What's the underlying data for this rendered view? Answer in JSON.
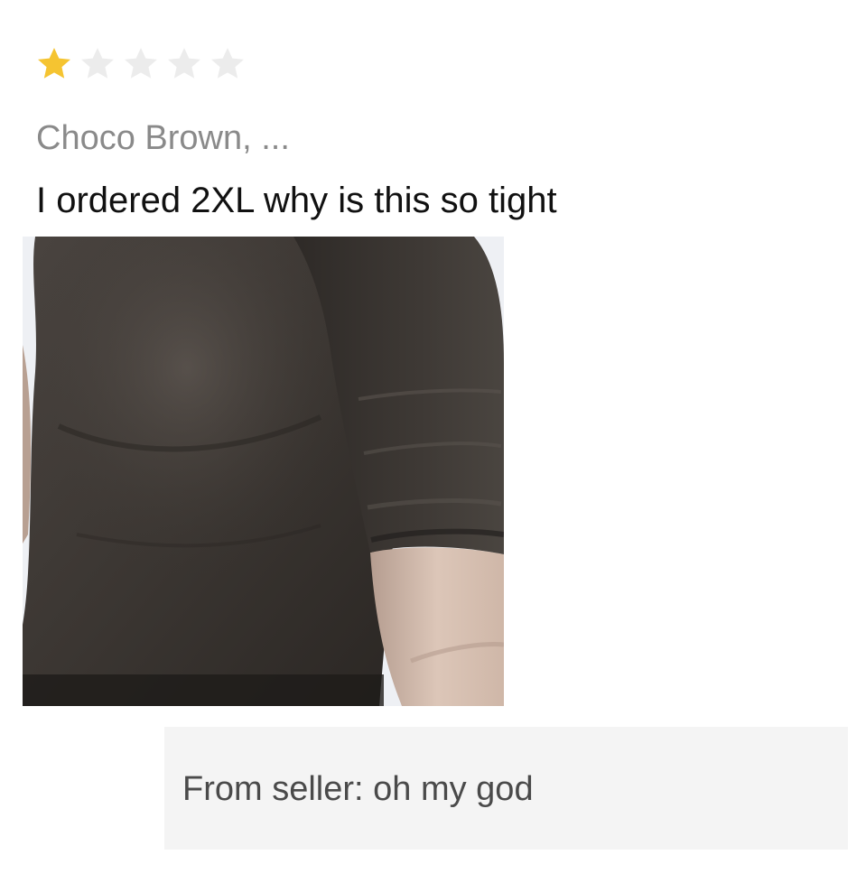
{
  "rating": {
    "value": 1,
    "max": 5,
    "filled_color": "#f5c431",
    "empty_color": "#ececec",
    "icon": "star-icon"
  },
  "review": {
    "reviewer": "Choco Brown, ...",
    "text": "I ordered 2XL why is this so tight"
  },
  "photo": {
    "colors": {
      "shirt": "#3b3632",
      "skin": "#dcc6b8",
      "shadow": "#1e1b19",
      "background": "#eef0f4"
    }
  },
  "seller_reply": {
    "text": "From seller: oh my god"
  }
}
